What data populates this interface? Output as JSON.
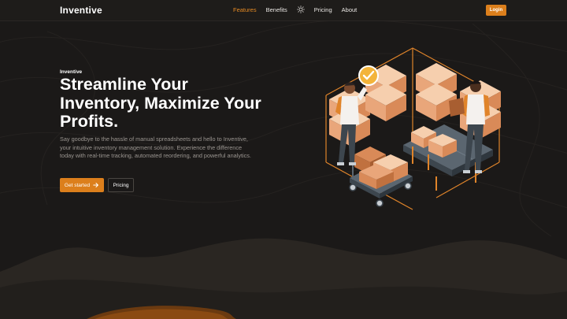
{
  "nav": {
    "brand": "Inventive",
    "links": [
      "Features",
      "Benefits",
      "Pricing",
      "About"
    ],
    "active": "Features",
    "theme_icon": "sun-icon",
    "login_label": "Login"
  },
  "hero": {
    "eyebrow": "Inventive",
    "headline": "Streamline Your Inventory, Maximize Your Profits.",
    "subtext": "Say goodbye to the hassle of manual spreadsheets and hello to Inventive, your intuitive inventory management solution. Experience the difference today with real-time tracking, automated reordering, and powerful analytics.",
    "primary_cta": "Get started",
    "primary_cta_icon": "arrow-right-icon",
    "secondary_cta": "Pricing",
    "illustration": "warehouse-workers-with-boxes-illustration"
  },
  "colors": {
    "background": "#1b1918",
    "accent": "#dc7f1c",
    "text_muted": "#9a9590"
  }
}
